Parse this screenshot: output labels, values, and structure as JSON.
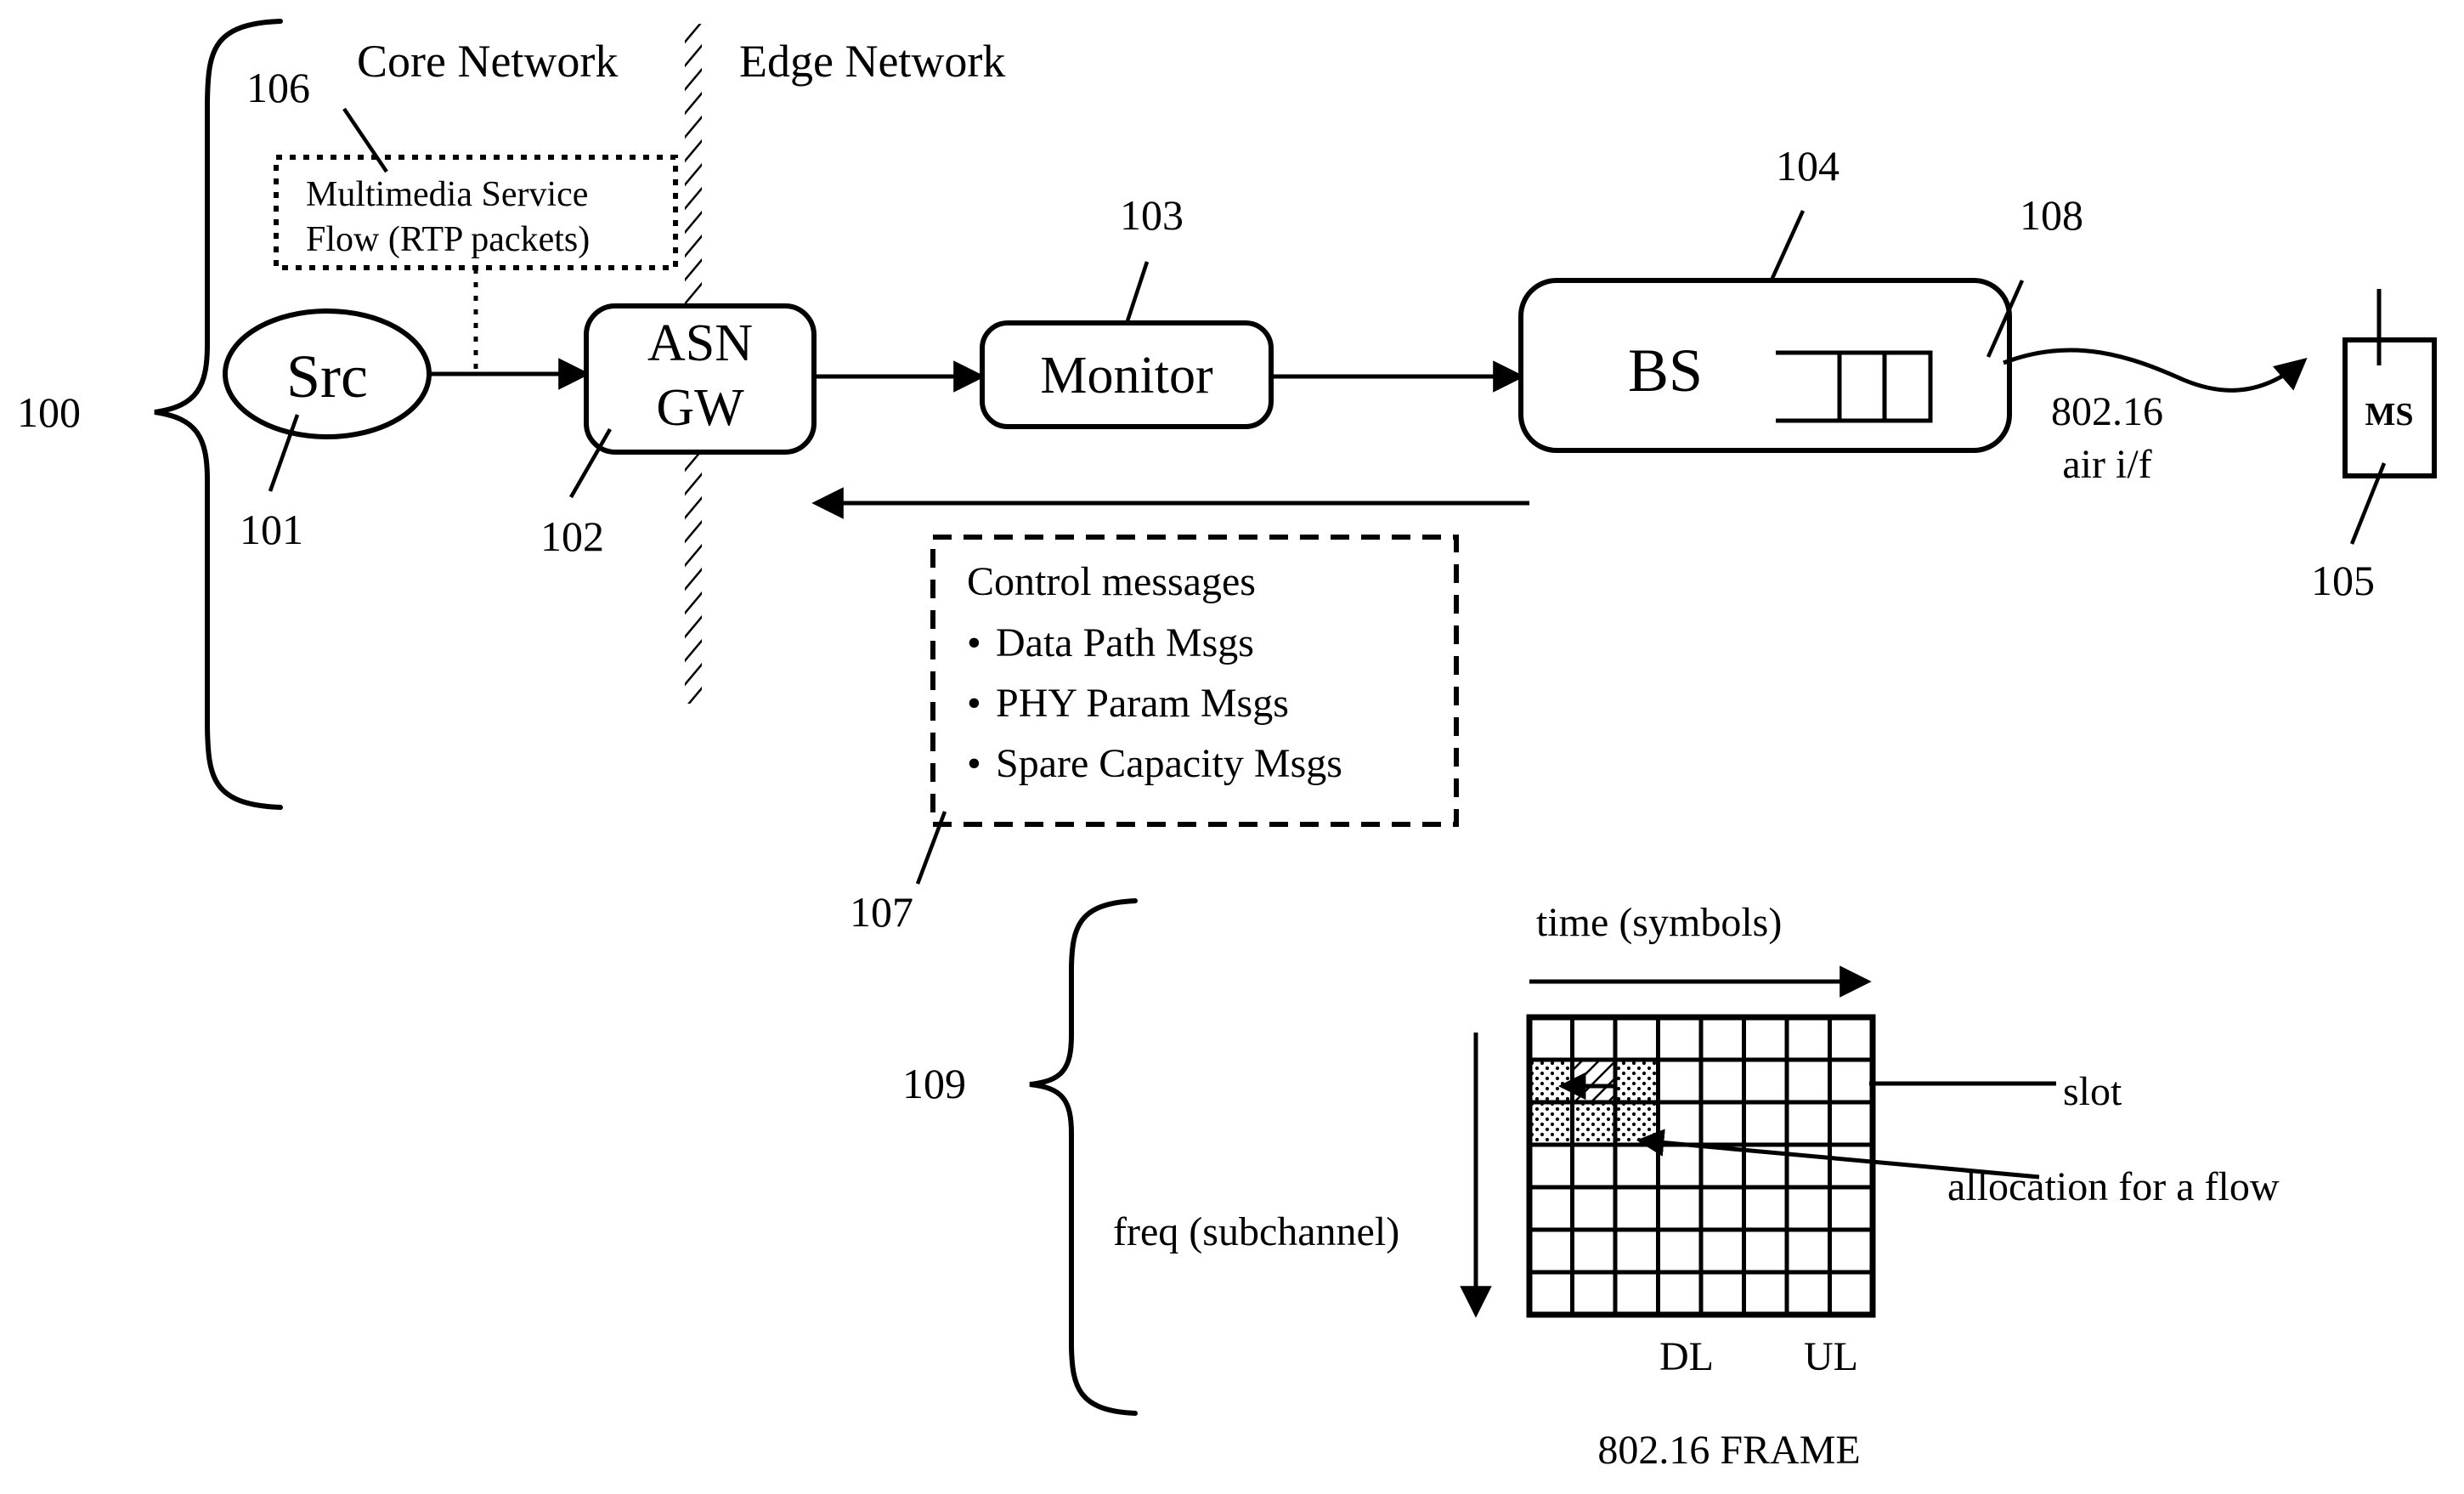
{
  "figure": {
    "title": "WiMAX network multimedia service flow block diagram",
    "refs": {
      "system": "100",
      "source": "101",
      "asn_gw": "102",
      "monitor": "103",
      "base_station": "104",
      "mobile_station": "105",
      "service_flow": "106",
      "control_messages": "107",
      "air_interface": "108",
      "frame": "109"
    },
    "network_zones": {
      "core": "Core Network",
      "edge": "Edge Network"
    },
    "nodes": {
      "src": "Src",
      "asn_line1": "ASN",
      "asn_line2": "GW",
      "monitor": "Monitor",
      "bs": "BS",
      "ms": "MS"
    },
    "service_flow_box": {
      "line1": "Multimedia Service",
      "line2": "Flow (RTP packets)"
    },
    "control_box": {
      "title": "Control messages",
      "bullets": [
        "Data Path Msgs",
        "PHY Param Msgs",
        "Spare Capacity Msgs"
      ],
      "bullet_glyph": "•"
    },
    "air_interface": {
      "line1": "802.16",
      "line2": "air i/f"
    },
    "frame_diagram": {
      "time_axis_label": "time (symbols)",
      "freq_axis_label": "freq (subchannel)",
      "dl_label": "DL",
      "ul_label": "UL",
      "caption": "802.16 FRAME",
      "slot_label": "slot",
      "allocation_label": "allocation for a flow",
      "columns": 8,
      "rows": 7,
      "allocated_cells": [
        {
          "col": 0,
          "row": 1
        },
        {
          "col": 1,
          "row": 1
        },
        {
          "col": 2,
          "row": 1
        },
        {
          "col": 0,
          "row": 2
        },
        {
          "col": 1,
          "row": 2
        },
        {
          "col": 2,
          "row": 2
        }
      ]
    },
    "colors": {
      "ink": "#000000",
      "paper": "#ffffff",
      "shade": "#d9d9d9"
    }
  }
}
